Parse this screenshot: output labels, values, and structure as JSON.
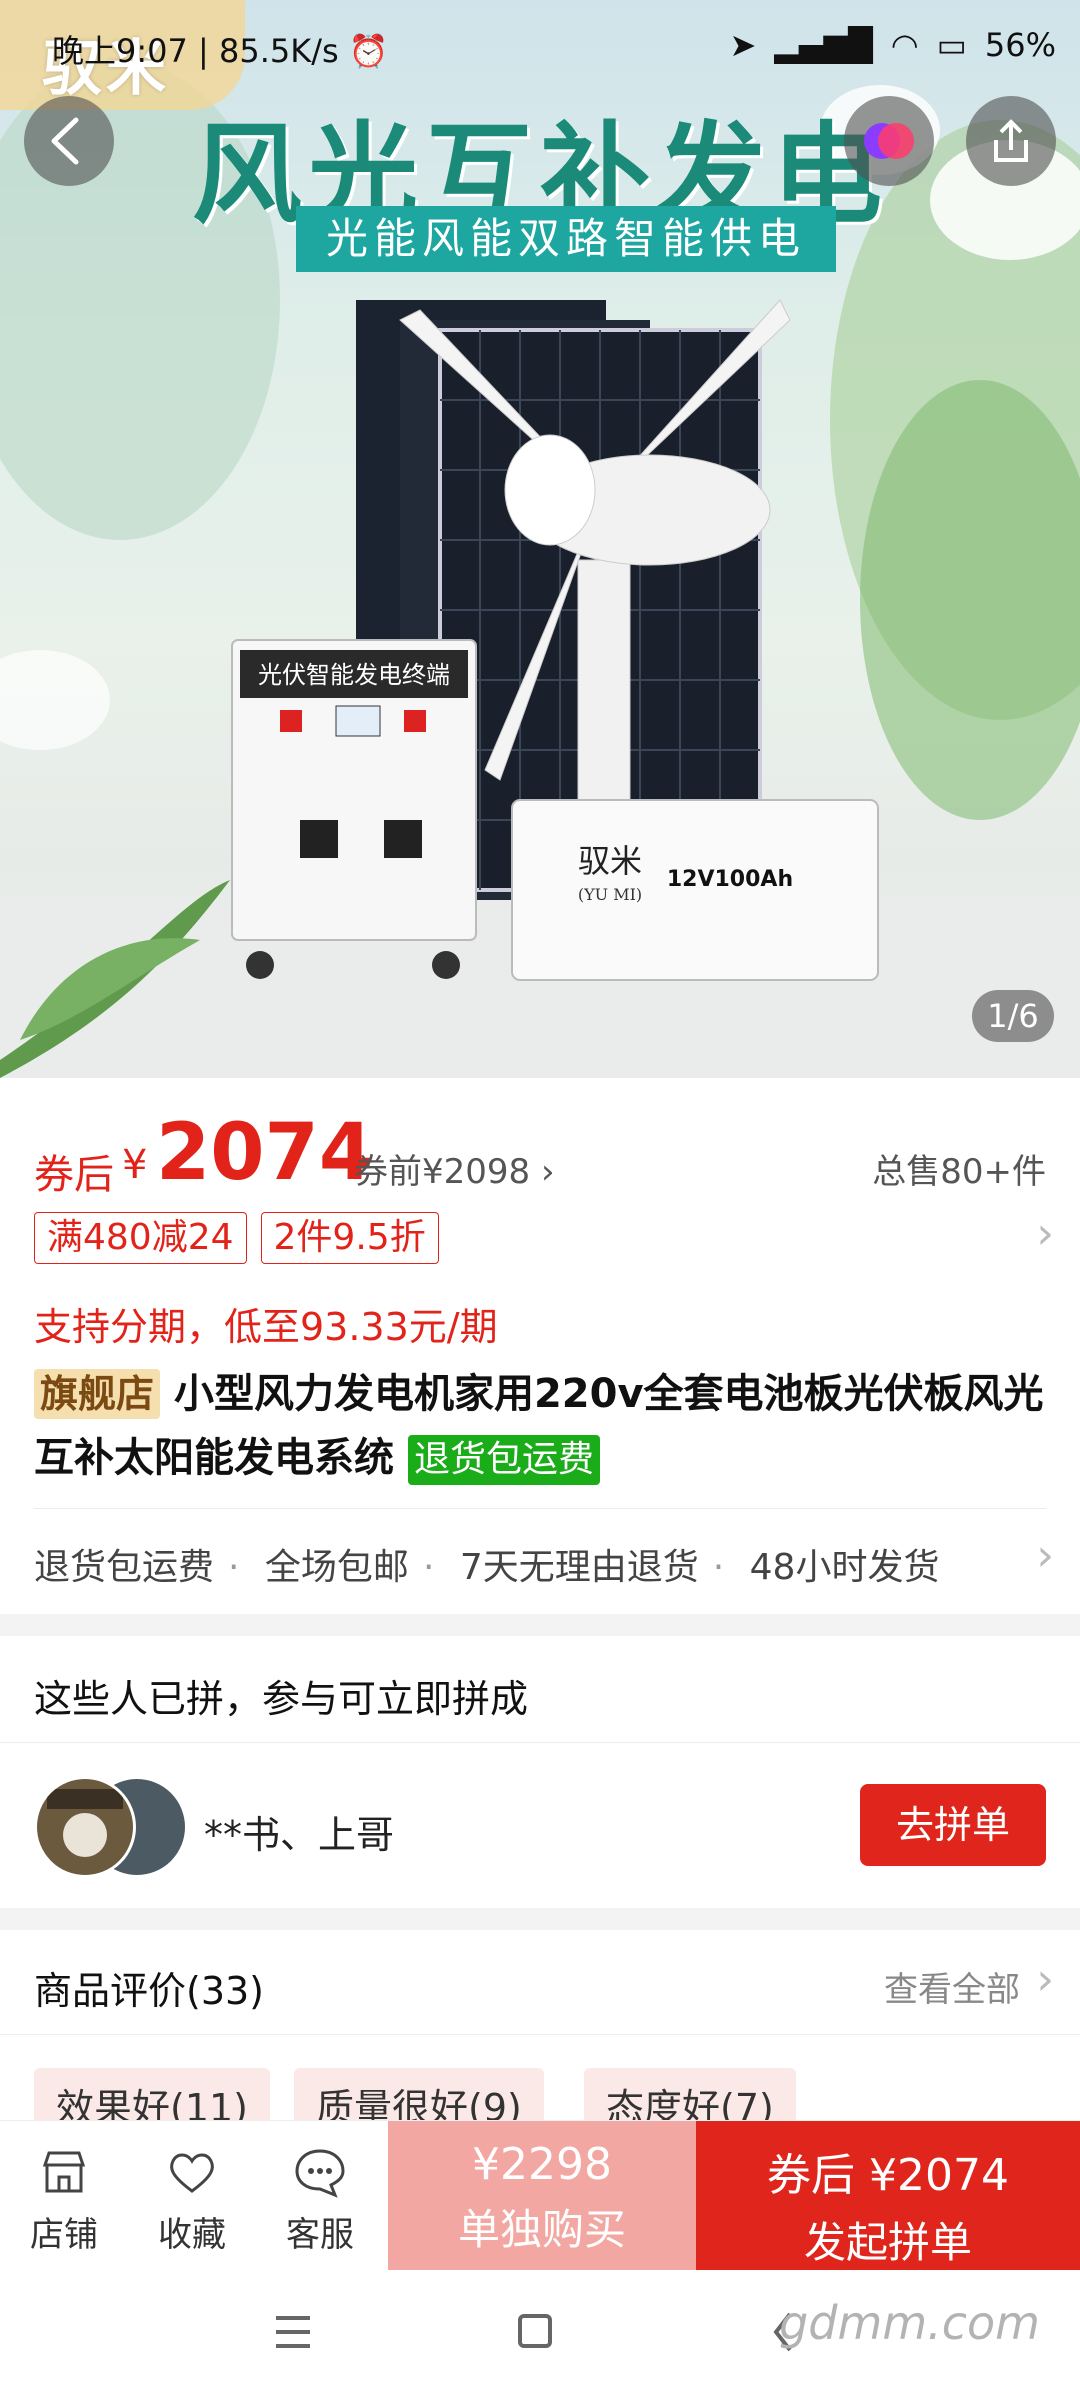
{
  "status_bar": {
    "time": "晚上9:07",
    "net_speed": "85.5K/s",
    "battery": "56%"
  },
  "hero": {
    "shop_logo_text": "驭米",
    "title": "风光互补发电",
    "subtitle": "光能风能双路智能供电",
    "device_label": "光伏智能发电终端",
    "battery_brand": "驭米",
    "battery_brand_en": "(YU MI)",
    "battery_spec": "12V100Ah",
    "image_counter": "1/6"
  },
  "price": {
    "coupon_label": "券后",
    "currency": "¥",
    "amount": "2074",
    "before_coupon": "券前¥2098",
    "total_sold": "总售80+件"
  },
  "promo_tags": [
    "满480减24",
    "2件9.5折"
  ],
  "installment": "支持分期，低至93.33元/期",
  "product": {
    "flagship_tag": "旗舰店",
    "title": "小型风力发电机家用220v全套电池板光伏板风光互补太阳能发电系统",
    "return_tag": "退货包运费"
  },
  "services": [
    "退货包运费",
    "全场包邮",
    "7天无理由退货",
    "48小时发货"
  ],
  "group_buy": {
    "title": "这些人已拼，参与可立即拼成",
    "names": "**书、上哥",
    "join_label": "去拼单"
  },
  "reviews": {
    "title": "商品评价(33)",
    "view_all": "查看全部",
    "chips": [
      "效果好(11)",
      "质量很好(9)",
      "态度好(7)"
    ]
  },
  "bottom_bar": {
    "shop_label": "店铺",
    "favorite_label": "收藏",
    "service_label": "客服",
    "alone_price": "¥2298",
    "alone_label": "单独购买",
    "group_price": "券后 ¥2074",
    "group_label": "发起拼单"
  },
  "watermark": "gdmm.com",
  "colors": {
    "accent_red": "#e2231a",
    "teal": "#1ea6a0",
    "green_tag": "#1aac19",
    "flag_tag_bg": "#f6dfae"
  }
}
